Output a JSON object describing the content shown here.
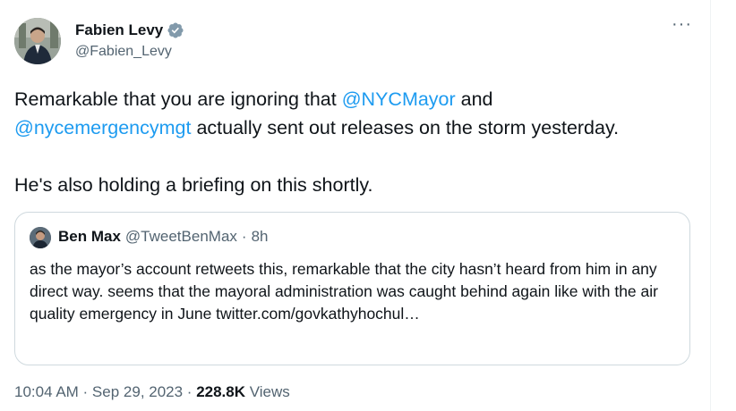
{
  "author": {
    "display_name": "Fabien Levy",
    "handle": "@Fabien_Levy",
    "verified": true,
    "avatar_icon": "profile-photo-icon"
  },
  "more_menu": {
    "label": "···"
  },
  "tweet": {
    "line1_before": "Remarkable that you are ignoring that ",
    "mention1": "@NYCMayor",
    "line1_after": " and",
    "mention2": "@nycemergencymgt",
    "line2_after": " actually sent out releases on the storm yesterday.",
    "paragraph2": "He's also holding a briefing on this shortly."
  },
  "quoted_tweet": {
    "display_name": "Ben Max",
    "handle": "@TweetBenMax",
    "separator": "·",
    "time": "8h",
    "text": "as the mayor’s account retweets this, remarkable that the city hasn’t heard from him in any direct way. seems that the mayoral administration was caught behind again like with the air quality emergency in June twitter.com/govkathyhochul…"
  },
  "meta": {
    "timestamp": "10:04 AM · Sep 29, 2023 · ",
    "views_count": "228.8K",
    "views_label": " Views"
  },
  "colors": {
    "link": "#1d9bf0",
    "text_primary": "#0f1419",
    "text_secondary": "#536471",
    "border": "#cfd9de",
    "verified_badge": "#829aab"
  }
}
